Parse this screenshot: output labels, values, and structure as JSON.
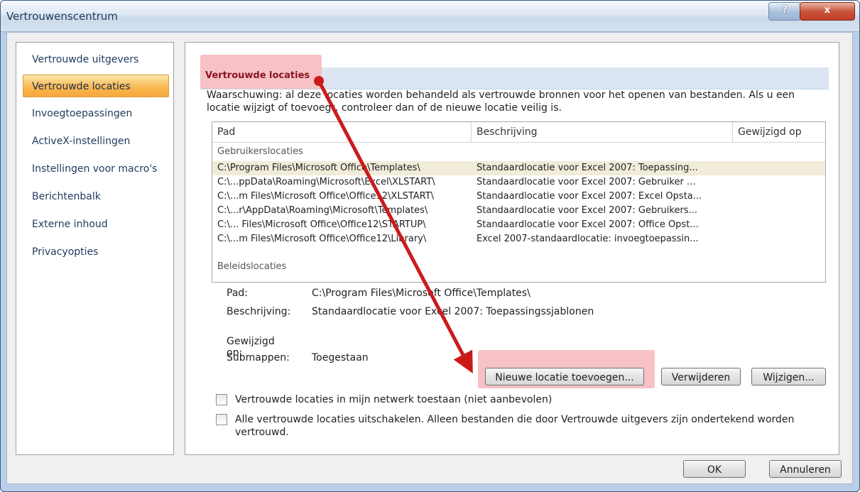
{
  "window": {
    "title": "Vertrouwenscentrum",
    "help_label": "?",
    "close_label": "x"
  },
  "sidebar": {
    "items": [
      {
        "label": "Vertrouwde uitgevers"
      },
      {
        "label": "Vertrouwde locaties"
      },
      {
        "label": "Invoegtoepassingen"
      },
      {
        "label": "ActiveX-instellingen"
      },
      {
        "label": "Instellingen voor macro's"
      },
      {
        "label": "Berichtenbalk"
      },
      {
        "label": "Externe inhoud"
      },
      {
        "label": "Privacyopties"
      }
    ],
    "active_index": 1
  },
  "main": {
    "section_title": "Vertrouwde locaties",
    "warning": "Waarschuwing: al deze locaties worden behandeld als vertrouwde bronnen voor het openen van bestanden. Als u een locatie wijzigt of toevoegt, controleer dan of de nieuwe locatie veilig is.",
    "columns": [
      "Pad",
      "Beschrijving",
      "Gewijzigd op"
    ],
    "user_group_label": "Gebruikerslocaties",
    "rows": [
      {
        "path": "C:\\Program Files\\Microsoft Office\\Templates\\",
        "desc": "Standaardlocatie voor Excel 2007: Toepassing...",
        "date": ""
      },
      {
        "path": "C:\\...ppData\\Roaming\\Microsoft\\Excel\\XLSTART\\",
        "desc": "Standaardlocatie voor Excel 2007: Gebruiker ...",
        "date": ""
      },
      {
        "path": "C:\\...m Files\\Microsoft Office\\Office12\\XLSTART\\",
        "desc": "Standaardlocatie voor Excel 2007: Excel Opsta...",
        "date": ""
      },
      {
        "path": "C:\\...r\\AppData\\Roaming\\Microsoft\\Templates\\",
        "desc": "Standaardlocatie voor Excel 2007: Gebruikers...",
        "date": ""
      },
      {
        "path": "C:\\... Files\\Microsoft Office\\Office12\\STARTUP\\",
        "desc": "Standaardlocatie voor Excel 2007: Office Opst...",
        "date": ""
      },
      {
        "path": "C:\\...m Files\\Microsoft Office\\Office12\\Library\\",
        "desc": "Excel 2007-standaardlocatie: invoegtoepassin...",
        "date": ""
      }
    ],
    "selected_row": 0,
    "policy_group_label": "Beleidslocaties",
    "details": {
      "path_label": "Pad:",
      "path_value": "C:\\Program Files\\Microsoft Office\\Templates\\",
      "desc_label": "Beschrijving:",
      "desc_value": "Standaardlocatie voor Excel 2007: Toepassingssjablonen",
      "date_label": "Gewijzigd op:",
      "date_value": "",
      "sub_label": "Submappen:",
      "sub_value": "Toegestaan"
    },
    "buttons": {
      "add": "Nieuwe locatie toevoegen...",
      "remove": "Verwijderen",
      "modify": "Wijzigen..."
    },
    "checkboxes": [
      {
        "label": "Vertrouwde locaties in mijn netwerk toestaan (niet aanbevolen)",
        "checked": false
      },
      {
        "label": "Alle vertrouwde locaties uitschakelen. Alleen bestanden die door Vertrouwde uitgevers zijn ondertekend worden vertrouwd.",
        "checked": false
      }
    ]
  },
  "footer": {
    "ok": "OK",
    "cancel": "Annuleren"
  },
  "colors": {
    "highlight": "#f6c2c6",
    "arrow": "#cc1a1a",
    "active_item": "#f8b64e"
  }
}
